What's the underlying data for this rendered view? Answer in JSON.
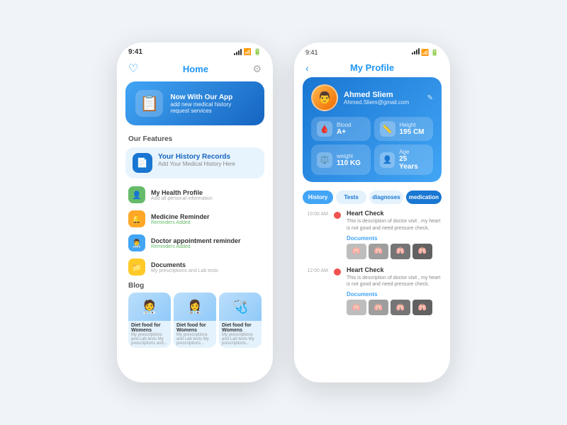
{
  "leftPhone": {
    "statusBar": {
      "time": "9:41"
    },
    "header": {
      "title": "Home"
    },
    "banner": {
      "title": "Now With Our App",
      "subtitle": "add new medical history\nrequest services"
    },
    "featuresSection": "Our Features",
    "featureBox": {
      "title": "Your History Records",
      "subtitle": "Add Your Medical History Here"
    },
    "menuItems": [
      {
        "label": "My Health Profile",
        "sublabel": "Add all personal information",
        "color": "green"
      },
      {
        "label": "Medicine Reminder",
        "sublabel": "Reminders Added",
        "color": "orange"
      },
      {
        "label": "Doctor appointment reminder",
        "sublabel": "Reminders Added",
        "color": "blue"
      },
      {
        "label": "Documents",
        "sublabel": "My prescriptions and Lab tests",
        "color": "yellow"
      }
    ],
    "blogSection": "Blog",
    "blogCards": [
      {
        "title": "Diet food for Womens",
        "sub": "My prescriptions and Lab tests My prescriptions and..."
      },
      {
        "title": "Diet food for Womens",
        "sub": "My prescriptions and Lab tests My prescriptions..."
      },
      {
        "title": "Diet food for Womens",
        "sub": "My prescriptions and Lab tests My prescriptions..."
      }
    ]
  },
  "rightPhone": {
    "statusBar": {
      "time": "9:41"
    },
    "header": {
      "title": "My Profile"
    },
    "profile": {
      "name": "Ahmed Sliem",
      "email": "Ahmed.Sliem@gmail.com",
      "editIcon": "✎"
    },
    "stats": [
      {
        "icon": "🩸",
        "label": "Blood",
        "value": "A+"
      },
      {
        "icon": "📏",
        "label": "Height",
        "value": "195 CM"
      },
      {
        "icon": "⚖️",
        "label": "weight",
        "value": "110 KG"
      },
      {
        "icon": "👤",
        "label": "Age",
        "value": "25 Years"
      }
    ],
    "tabs": [
      {
        "label": "History",
        "active": true
      },
      {
        "label": "Tests",
        "active": false
      },
      {
        "label": "diagnoses",
        "active": false
      },
      {
        "label": "medication",
        "active": false
      }
    ],
    "timeline": [
      {
        "time": "10:00 AM",
        "title": "Heart Check",
        "desc": "This is description of doctor visit , my heart is not good and need pressure check.",
        "docsLabel": "Documents",
        "images": 4
      },
      {
        "time": "12:00 AM",
        "title": "Heart Check",
        "desc": "This is description of doctor visit , my heart is not good and need pressure check.",
        "docsLabel": "Documents",
        "images": 4
      }
    ]
  }
}
